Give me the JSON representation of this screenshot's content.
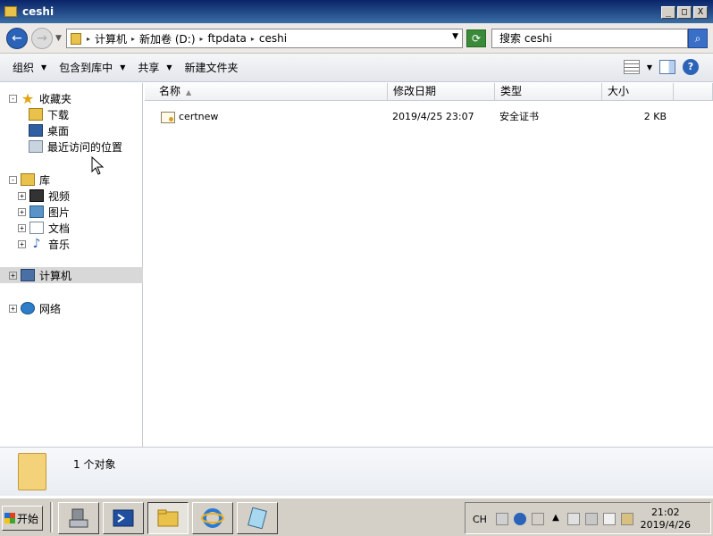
{
  "window": {
    "title": "ceshi",
    "min_glyph": "_",
    "max_glyph": "□",
    "close_glyph": "X"
  },
  "address": {
    "crumbs": [
      "计算机",
      "新加卷 (D:)",
      "ftpdata",
      "ceshi"
    ],
    "search_placeholder": "搜索 ceshi"
  },
  "toolbar": {
    "organize": "组织",
    "include_in_library": "包含到库中",
    "share": "共享",
    "new_folder": "新建文件夹"
  },
  "nav": {
    "favorites": "收藏夹",
    "downloads": "下载",
    "desktop": "桌面",
    "recent": "最近访问的位置",
    "libraries": "库",
    "videos": "视频",
    "pictures": "图片",
    "documents": "文档",
    "music": "音乐",
    "computer": "计算机",
    "network": "网络"
  },
  "columns": {
    "name": "名称",
    "modified": "修改日期",
    "type": "类型",
    "size": "大小"
  },
  "files": [
    {
      "name": "certnew",
      "modified": "2019/4/25 23:07",
      "type": "安全证书",
      "size": "2 KB"
    }
  ],
  "details": {
    "count": "1 个对象"
  },
  "taskbar": {
    "start": "开始",
    "lang": "CH",
    "time": "21:02",
    "date": "2019/4/26"
  },
  "colors": {
    "titlebar": "#0a246a",
    "selection": "#d8d8d8",
    "taskbar": "#d4d0c8"
  }
}
